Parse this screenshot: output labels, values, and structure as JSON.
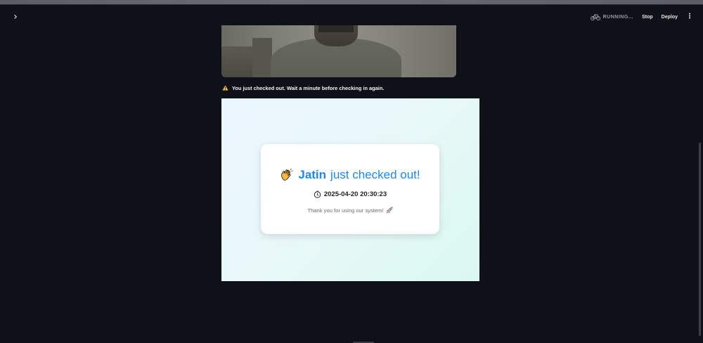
{
  "header": {
    "sidebar_toggle_glyph": "›",
    "status": "RUNNING...",
    "stop_label": "Stop",
    "deploy_label": "Deploy",
    "menu_glyph": "⋮"
  },
  "alert": {
    "message": "You just checked out. Wait a minute before checking in again.",
    "color": "#ffbd45"
  },
  "card": {
    "name": "Jatin",
    "title_suffix": "just checked out!",
    "timestamp": "2025-04-20 20:30:23",
    "thanks": "Thank you for using our system!",
    "accent_color": "#1e88e5",
    "icons": [
      "waving-hand-icon",
      "clock-icon",
      "rocket-icon"
    ]
  },
  "colors": {
    "background": "#0e1117",
    "panel_gradient_start": "#ebf5fe",
    "panel_gradient_end": "#d9f8f0"
  }
}
